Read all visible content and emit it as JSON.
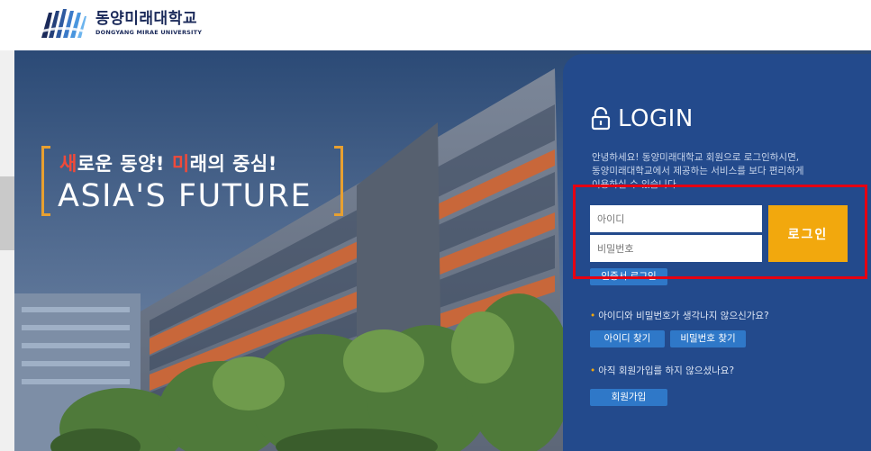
{
  "header": {
    "logo_kr": "동양미래대학교",
    "logo_en": "DONGYANG MIRAE UNIVERSITY"
  },
  "hero": {
    "slogan_part1_hl": "새",
    "slogan_part1_rest": "로운 동양! ",
    "slogan_part2_hl": "미",
    "slogan_part2_rest": "래의 중심!",
    "slogan_en": "ASIA'S FUTURE"
  },
  "login": {
    "title": "LOGIN",
    "desc_lines": [
      "안녕하세요! 동양미래대학교 회원으로 로그인하시면,",
      "동양미래대학교에서 제공하는 서비스를 보다 편리하게",
      "이용하실 수 있습니다."
    ],
    "id_placeholder": "아이디",
    "pw_placeholder": "비밀번호",
    "login_button": "로그인",
    "cert_login": "인증서 로그인",
    "faq_forgot": "아이디와 비밀번호가 생각나지 않으신가요?",
    "find_id": "아이디 찾기",
    "find_pw": "비밀번호 찾기",
    "faq_join": "아직 회원가입를 하지 않으셨나요?",
    "join": "회원가입"
  },
  "colors": {
    "panel": "#234a8c",
    "login_button": "#f2a80d",
    "small_button": "#2f78c8",
    "highlight": "#e60012",
    "slogan_bracket": "#e8a030",
    "slogan_highlight": "#f04a3a"
  },
  "icons": [
    "university-logo-icon",
    "lock-icon"
  ]
}
